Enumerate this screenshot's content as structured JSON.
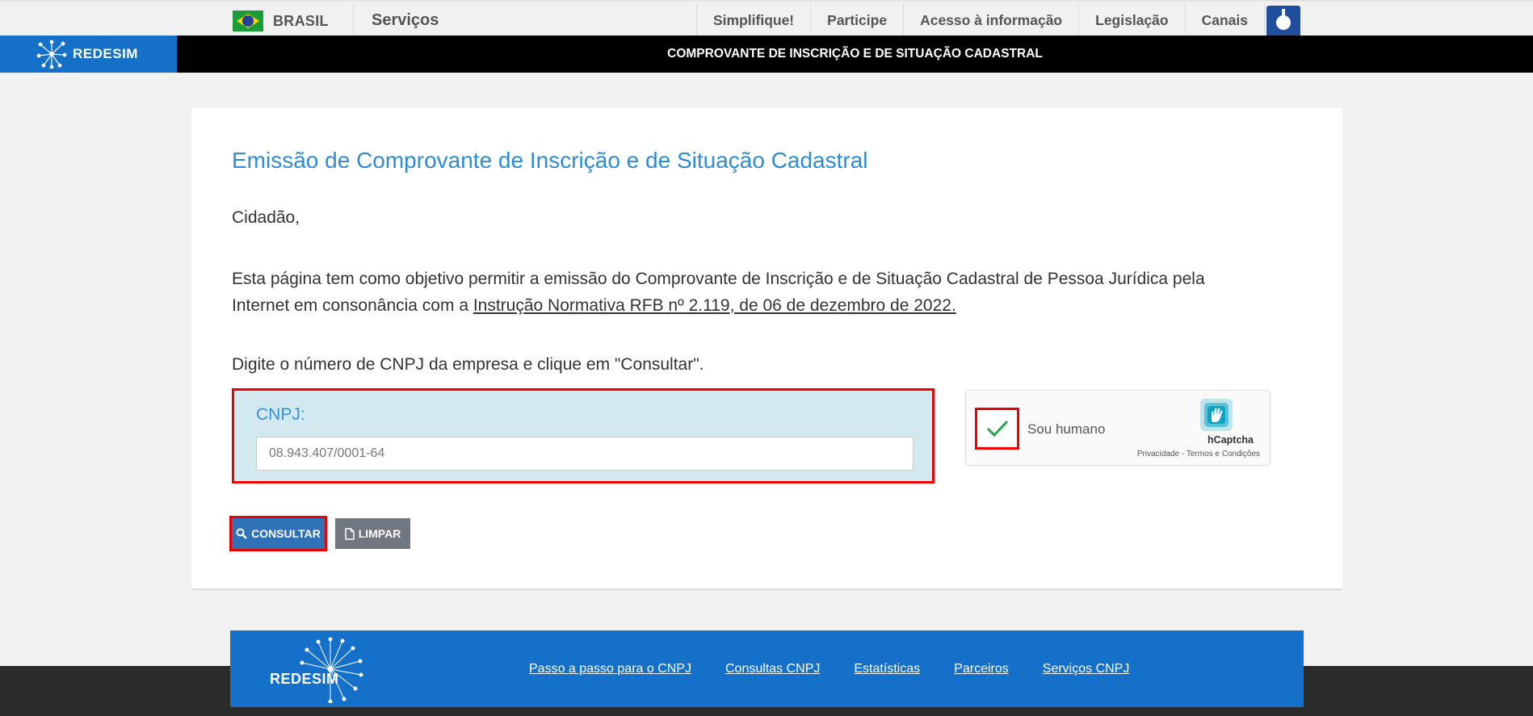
{
  "gov_bar": {
    "country": "BRASIL",
    "services": "Serviços",
    "nav": [
      "Simplifique!",
      "Participe",
      "Acesso à informação",
      "Legislação",
      "Canais"
    ]
  },
  "header": {
    "logo_text": "REDESIM",
    "title": "COMPROVANTE DE INSCRIÇÃO E DE SITUAÇÃO CADASTRAL"
  },
  "main": {
    "title": "Emissão de Comprovante de Inscrição e de Situação Cadastral",
    "greeting": "Cidadão,",
    "description_prefix": "Esta página tem como objetivo permitir a emissão do Comprovante de Inscrição e de Situação Cadastral de Pessoa Jurídica pela Internet em consonância com a ",
    "description_link": "Instrução Normativa RFB nº 2.119, de 06 de dezembro de 2022.",
    "instruction": "Digite o número de CNPJ da empresa e clique em \"Consultar\".",
    "cnpj_label": "CNPJ:",
    "cnpj_value": "08.943.407/0001-64"
  },
  "captcha": {
    "label": "Sou humano",
    "brand": "hCaptcha",
    "links": "Privacidade - Termos e Condições",
    "checked": true
  },
  "buttons": {
    "consultar": "CONSULTAR",
    "limpar": "LIMPAR"
  },
  "footer": {
    "logo_text": "REDESIM",
    "links": [
      "Passo a passo para o CNPJ",
      "Consultas CNPJ",
      "Estatísticas",
      "Parceiros",
      "Serviços CNPJ"
    ]
  },
  "colors": {
    "brand_blue": "#1470c9",
    "title_blue": "#2e8bd4",
    "highlight_red": "#e00000",
    "captcha_check_green": "#2da44e"
  }
}
